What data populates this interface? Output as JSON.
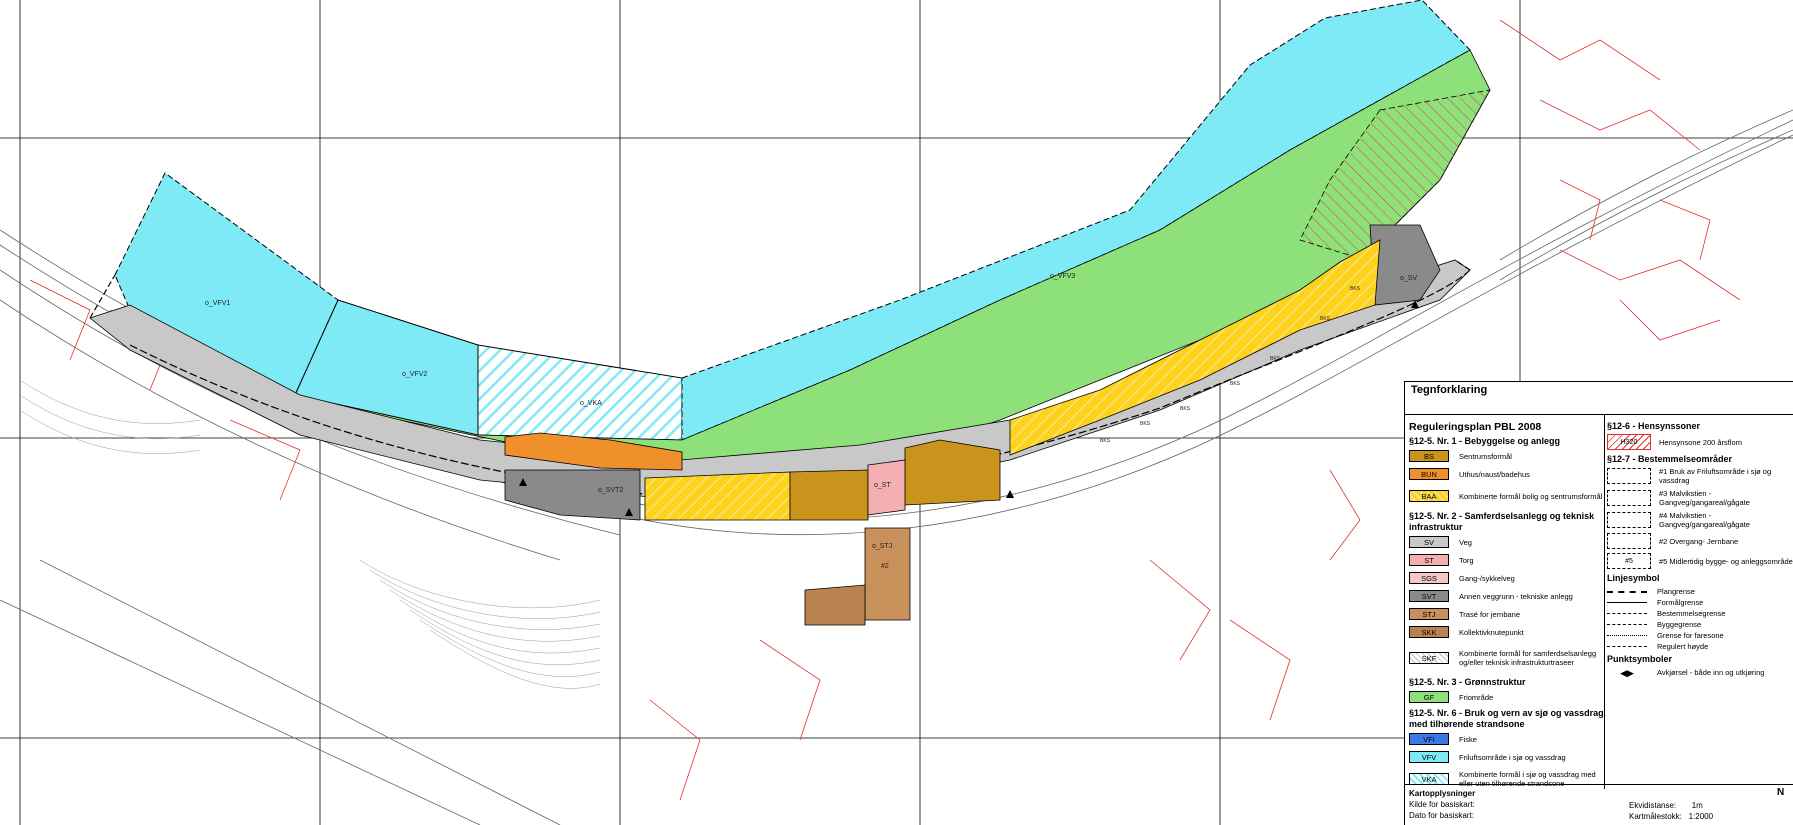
{
  "map": {
    "zones": {
      "vfv1": "o_VFV1",
      "vfv2": "o_VFV2",
      "vfv3": "o_VFV3",
      "vka": "o_VKA",
      "svt2": "o_SVT2",
      "st": "o_ST",
      "stj": "o_STJ",
      "num2": "#2",
      "sv": "o_SV"
    },
    "small_labels": [
      "BKS",
      "BKS",
      "BKS",
      "BKS",
      "BKS",
      "BKS",
      "BKS"
    ]
  },
  "legend": {
    "title": "Tegnforklaring",
    "plan_title": "Reguleringsplan PBL 2008",
    "sections_left": [
      {
        "heading": "§12-5. Nr. 1 - Bebyggelse og anlegg",
        "items": [
          {
            "code": "BS",
            "label": "Sentrumsformål",
            "color": "#c8941b"
          },
          {
            "code": "BUN",
            "label": "Uthus/naust/badehus",
            "color": "#f0902a"
          },
          {
            "code": "BAA",
            "label": "Kombinerte formål bolig og sentrumsformål",
            "color": "#ffd21a"
          }
        ]
      },
      {
        "heading": "§12-5. Nr. 2 - Samferdselsanlegg og teknisk infrastruktur",
        "items": [
          {
            "code": "SV",
            "label": "Veg",
            "color": "#c8c8c8"
          },
          {
            "code": "ST",
            "label": "Torg",
            "color": "#f4b0b0"
          },
          {
            "code": "SGS",
            "label": "Gang-/sykkelveg",
            "color": "#f7c6c6"
          },
          {
            "code": "SVT",
            "label": "Annen veggrunn - tekniske anlegg",
            "color": "#8a8a8a"
          },
          {
            "code": "STJ",
            "label": "Trasé for jernbane",
            "color": "#c8905a"
          },
          {
            "code": "SKK",
            "label": "Kollektivknutepunkt",
            "color": "#b98250"
          },
          {
            "code": "SKF",
            "label": "Kombinerte formål for samferdselsanlegg og/eller teknisk infrastrukturtraseer",
            "color": "#ffffff"
          }
        ]
      },
      {
        "heading": "§12-5. Nr. 3 - Grønnstruktur",
        "items": [
          {
            "code": "GF",
            "label": "Friområde",
            "color": "#8ee07a"
          }
        ]
      },
      {
        "heading": "§12-5. Nr. 6 - Bruk og vern av sjø og vassdrag med tilhørende strandsone",
        "items": [
          {
            "code": "VFI",
            "label": "Fiske",
            "color": "#3a78e8"
          },
          {
            "code": "VFV",
            "label": "Friluftsområde i sjø og vassdrag",
            "color": "#7eeaf5"
          },
          {
            "code": "VKA",
            "label": "Kombinerte formål i sjø og vassdrag med eller uten tilhørende strandsone",
            "color": "#ffffff"
          }
        ]
      }
    ],
    "hensyn": {
      "heading": "§12-6 - Hensynssoner",
      "items": [
        {
          "code": "H320",
          "label": "Hensynsone 200 årsflom"
        }
      ]
    },
    "bestemmelse": {
      "heading": "§12-7 - Bestemmelseområder",
      "items": [
        {
          "code": "#1",
          "label": "#1 Bruk av Friluftsområde i sjø og vassdrag"
        },
        {
          "code": "#3",
          "label": "#3 Malvikstien - Gangveg/gangareal/gågate"
        },
        {
          "code": "#4",
          "label": "#4 Malvikstien - Gangveg/gangareal/gågate"
        },
        {
          "code": "#2",
          "label": "#2 Overgang- Jernbane"
        },
        {
          "code": "#5",
          "label": "#5 Midlertidig bygge- og anleggsområde"
        }
      ]
    },
    "linjesymbol": {
      "heading": "Linjesymbol",
      "items": [
        {
          "label": "Plangrense"
        },
        {
          "label": "Formålgrense"
        },
        {
          "label": "Bestemmelsegrense"
        },
        {
          "label": "Byggegrense"
        },
        {
          "label": "Grense for faresone"
        },
        {
          "label": "Regulert høyde"
        }
      ]
    },
    "punktsymbol": {
      "heading": "Punktsymboler",
      "items": [
        {
          "label": "Avkjørsel - både inn og utkjøring"
        }
      ]
    },
    "kart": {
      "heading": "Kartopplysninger",
      "kilde": "Kilde for basiskart:",
      "dato": "Dato for basiskart:",
      "ekvidistanse_label": "Ekvidistanse:",
      "ekvidistanse": "1m",
      "malestokk_label": "Kartmålestokk:",
      "malestokk": "1:2000",
      "north": "N"
    }
  }
}
